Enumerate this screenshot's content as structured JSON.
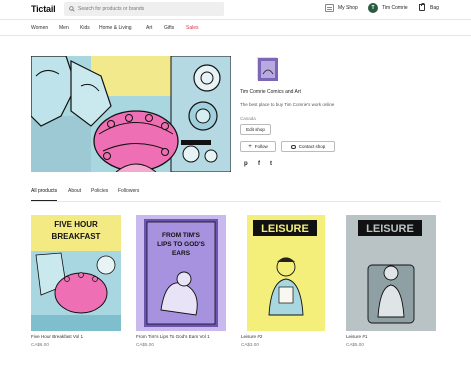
{
  "header": {
    "logo": "Tictail",
    "search_placeholder": "Search for products or brands",
    "my_shop": "My Shop",
    "user_initial": "T",
    "user_name": "Tim Comrie",
    "bag": "Bag"
  },
  "categories": [
    "Women",
    "Men",
    "Kids",
    "Home & Living",
    "Art",
    "Gifts",
    "Sales"
  ],
  "shop": {
    "name": "Tim Comrie Comics and Art",
    "tagline": "The best place to buy Tim Comrie's work online",
    "location": "Canada",
    "edit_label": "Edit shop",
    "follow_label": "Follow",
    "contact_label": "Contact shop",
    "social": [
      "p",
      "f",
      "t"
    ]
  },
  "tabs": [
    "All products",
    "About",
    "Policies",
    "Followers"
  ],
  "products": [
    {
      "name": "Five Hour Breakfast Vol 1",
      "price": "CA$6.00",
      "cover_title": "FIVE HOUR BREAKFAST"
    },
    {
      "name": "From Tim's Lips To God's Ears Vol 1",
      "price": "CA$5.00",
      "cover_title": "FROM TIM'S LIPS TO GOD'S EARS"
    },
    {
      "name": "Leisure #2",
      "price": "CA$3.00",
      "cover_title": "LEISURE"
    },
    {
      "name": "Leisure #1",
      "price": "CA$5.00",
      "cover_title": "LEISURE"
    }
  ],
  "colors": {
    "sale": "#d7354a",
    "avatar": "#2a5b3e"
  }
}
